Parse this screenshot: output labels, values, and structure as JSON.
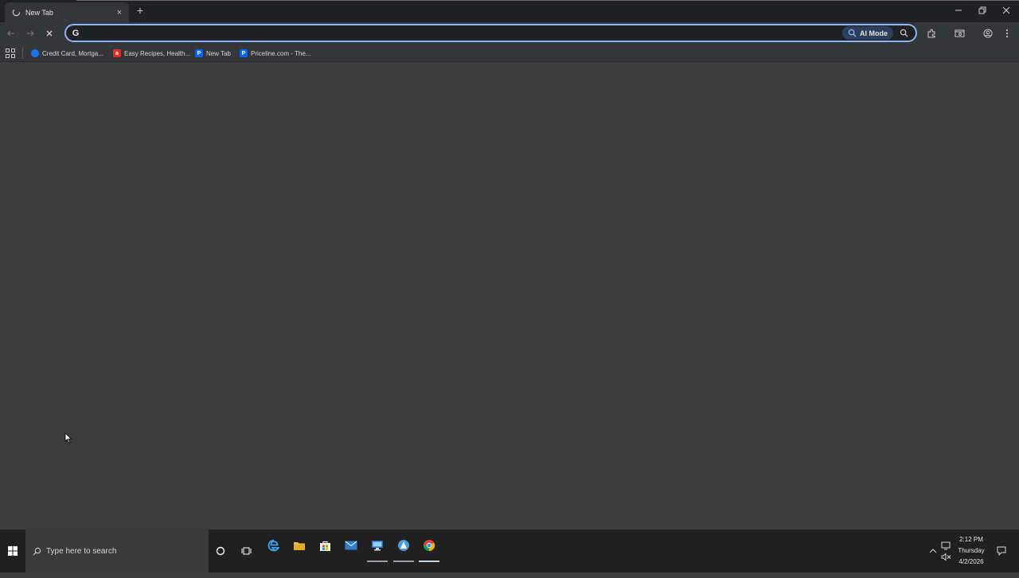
{
  "browser": {
    "tab": {
      "title": "New Tab",
      "close_label": "×"
    },
    "new_tab_label": "+",
    "window_controls": {
      "minimize": "—",
      "restore": "❐",
      "close": "✕"
    }
  },
  "toolbar": {
    "omnibox": {
      "value": "",
      "placeholder": "",
      "engine_logo": "G"
    },
    "ai_mode_label": "AI Mode",
    "icons": [
      "back-icon",
      "forward-icon",
      "stop-icon",
      "lens-icon",
      "extensions-icon",
      "tab-search-icon",
      "profile-icon",
      "menu-icon"
    ]
  },
  "bookmarks": [
    {
      "label": "Credit Card, Mortga...",
      "icon": "globe-icon",
      "color": "#1a73e8"
    },
    {
      "label": "Easy Recipes, Health...",
      "icon": "allrecipes-icon",
      "color": "#d93025"
    },
    {
      "label": "New Tab",
      "icon": "priceline-icon",
      "color": "#0066ff"
    },
    {
      "label": "Priceline.com - The...",
      "icon": "priceline-icon",
      "color": "#0066ff"
    }
  ],
  "taskbar": {
    "search_placeholder": "Type here to search",
    "apps": [
      "cortana-icon",
      "task-view-icon",
      "edge-icon",
      "file-explorer-icon",
      "store-icon",
      "mail-icon",
      "remote-desktop-icon",
      "app-icon",
      "chrome-icon"
    ],
    "clock": {
      "time": "2:12 PM",
      "day": "Thursday",
      "date": "4/2/2026"
    }
  },
  "colors": {
    "accent": "#8ab4f8",
    "content_bg": "#3c3c3c",
    "titlebar_bg": "#202124"
  }
}
